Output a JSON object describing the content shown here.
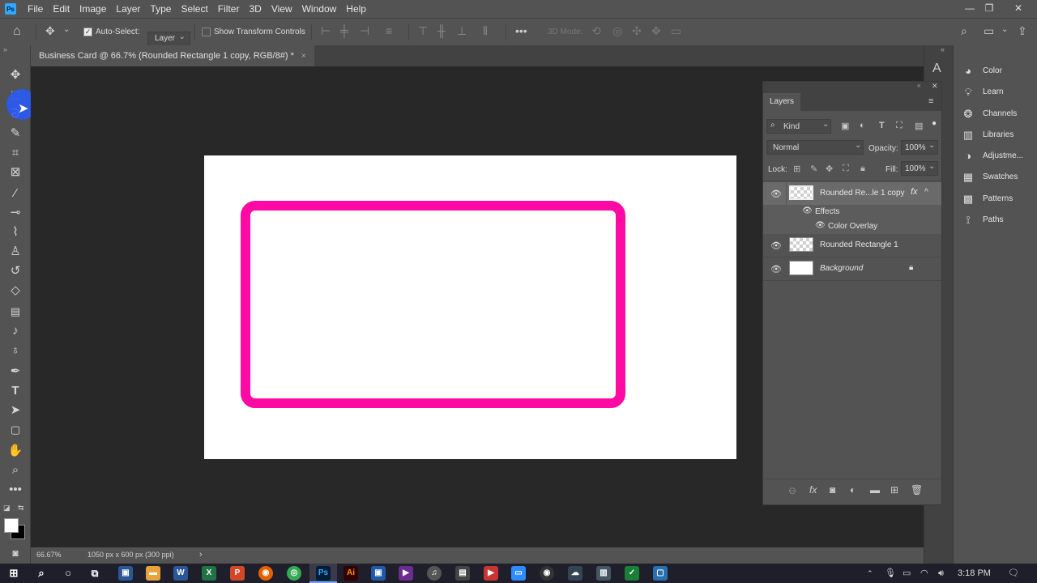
{
  "app": {
    "logo_text": "Ps",
    "menus": [
      "File",
      "Edit",
      "Image",
      "Layer",
      "Type",
      "Select",
      "Filter",
      "3D",
      "View",
      "Window",
      "Help"
    ],
    "window_controls": [
      "—",
      "❐",
      "✕"
    ]
  },
  "options_bar": {
    "auto_select_label": "Auto-Select:",
    "auto_select_target": "Layer",
    "show_transform_label": "Show Transform Controls",
    "threed_mode_label": "3D Mode:"
  },
  "document": {
    "tab_title": "Business Card @ 66.7% (Rounded Rectangle 1 copy, RGB/8#) *",
    "tab_close": "×",
    "shape_color": "#ff0aa3"
  },
  "status": {
    "zoom": "66.67%",
    "doc_info": "1050 px x 600 px (300 ppi)",
    "arrow": "›"
  },
  "layers_panel": {
    "title": "Layers",
    "filter_kind": "Kind",
    "blend_mode": "Normal",
    "opacity_label": "Opacity:",
    "opacity_value": "100%",
    "lock_label": "Lock:",
    "fill_label": "Fill:",
    "fill_value": "100%",
    "layers": [
      {
        "name": "Rounded Re...le 1 copy",
        "fx": "fx",
        "expand": "^"
      },
      {
        "name": "Effects"
      },
      {
        "name": "Color Overlay"
      },
      {
        "name": "Rounded Rectangle 1"
      },
      {
        "name": "Background"
      }
    ]
  },
  "right_dock": {
    "items": [
      {
        "label": "Color",
        "icon": "color-icon"
      },
      {
        "label": "Learn",
        "icon": "learn-icon"
      },
      {
        "label": "Channels",
        "icon": "channels-icon"
      },
      {
        "label": "Libraries",
        "icon": "libraries-icon"
      },
      {
        "label": "Adjustme...",
        "icon": "adjustments-icon"
      },
      {
        "label": "Swatches",
        "icon": "swatches-icon"
      },
      {
        "label": "Patterns",
        "icon": "patterns-icon"
      },
      {
        "label": "Paths",
        "icon": "paths-icon"
      }
    ]
  },
  "taskbar": {
    "time": "3:18 PM",
    "photoshop_label": "Ps",
    "illustrator_label": "Ai"
  }
}
